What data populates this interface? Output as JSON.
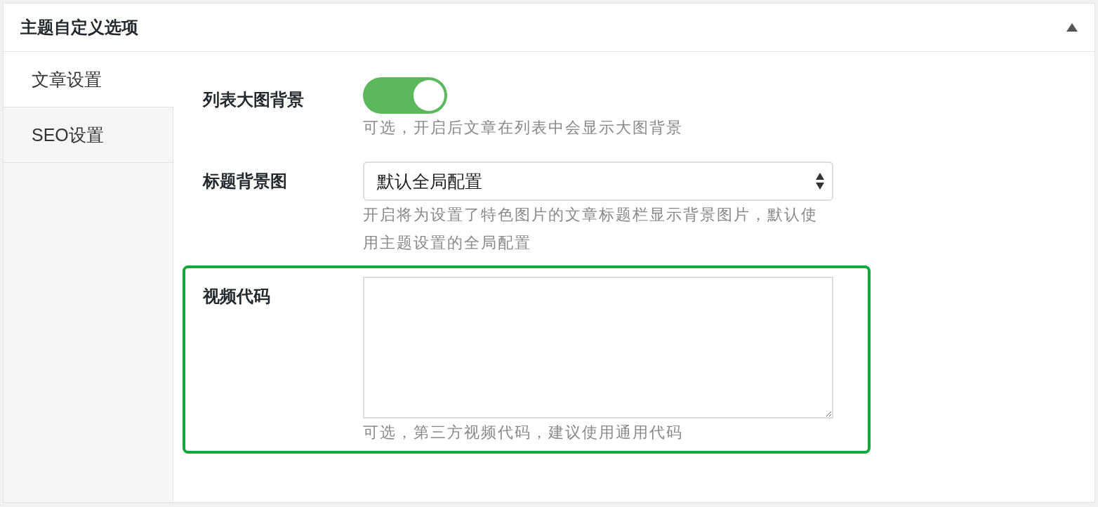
{
  "panel": {
    "title": "主题自定义选项",
    "expanded": true
  },
  "tabs": [
    {
      "label": "文章设置",
      "selected": true
    },
    {
      "label": "SEO设置",
      "selected": false
    }
  ],
  "fields": [
    {
      "kind": "toggle",
      "label": "列表大图背景",
      "on": true,
      "description": "可选，开启后文章在列表中会显示大图背景",
      "highlighted": false
    },
    {
      "kind": "select",
      "label": "标题背景图",
      "value": "默认全局配置",
      "description": "开启将为设置了特色图片的文章标题栏显示背景图片，默认使用主题设置的全局配置",
      "highlighted": false
    },
    {
      "kind": "textarea",
      "label": "视频代码",
      "description": "可选，第三方视频代码，建议使用通用代码",
      "highlighted": true
    }
  ]
}
